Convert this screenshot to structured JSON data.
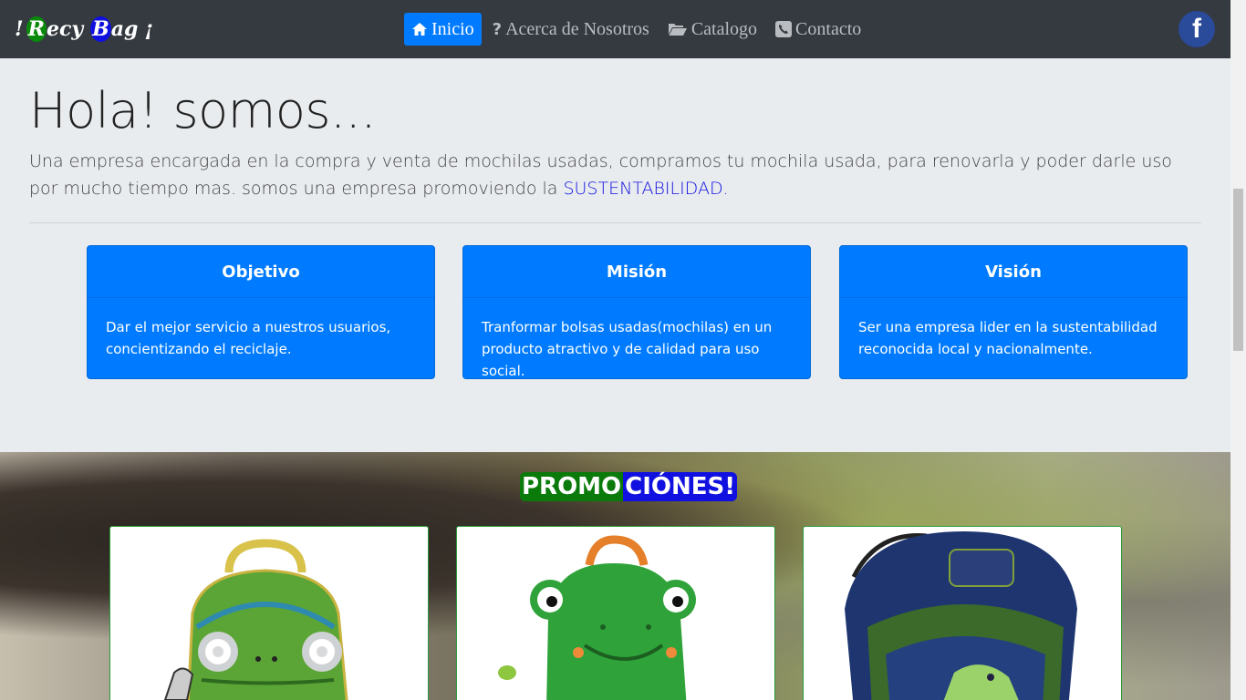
{
  "brand": {
    "excl": "!",
    "word1_first": "R",
    "word1_rest": "ecy",
    "word2_first": "B",
    "word2_rest": "ag",
    "inv": "¡"
  },
  "nav": [
    {
      "label": "Inicio",
      "icon": "home-icon",
      "active": true
    },
    {
      "label": "Acerca de Nosotros",
      "icon": "question-icon"
    },
    {
      "label": "Catalogo",
      "icon": "folder-open-icon"
    },
    {
      "label": "Contacto",
      "icon": "phone-icon"
    }
  ],
  "social": {
    "facebook": "f"
  },
  "hero": {
    "title": "Hola! somos...",
    "lead": "Una empresa encargada en la compra y venta de mochilas usadas, compramos tu mochila usada, para renovarla y poder darle uso por mucho tiempo mas. somos una empresa promoviendo la ",
    "highlight": "SUSTENTABILIDAD."
  },
  "cards": [
    {
      "title": "Objetivo",
      "body": "Dar el mejor servicio a nuestros usuarios, concientizando el reciclaje."
    },
    {
      "title": "Misión",
      "body": "Tranformar bolsas usadas(mochilas) en un producto atractivo y de calidad para uso social."
    },
    {
      "title": "Visión",
      "body": "Ser una empresa lider en la sustentabilidad reconocida local y nacionalmente."
    }
  ],
  "promo": {
    "part1": "PROMO",
    "part2": "CIÓNES!"
  },
  "colors": {
    "navbar": "#343a40",
    "primary": "#007bff",
    "green": "#0a7a0a",
    "blue": "#1010e0"
  }
}
